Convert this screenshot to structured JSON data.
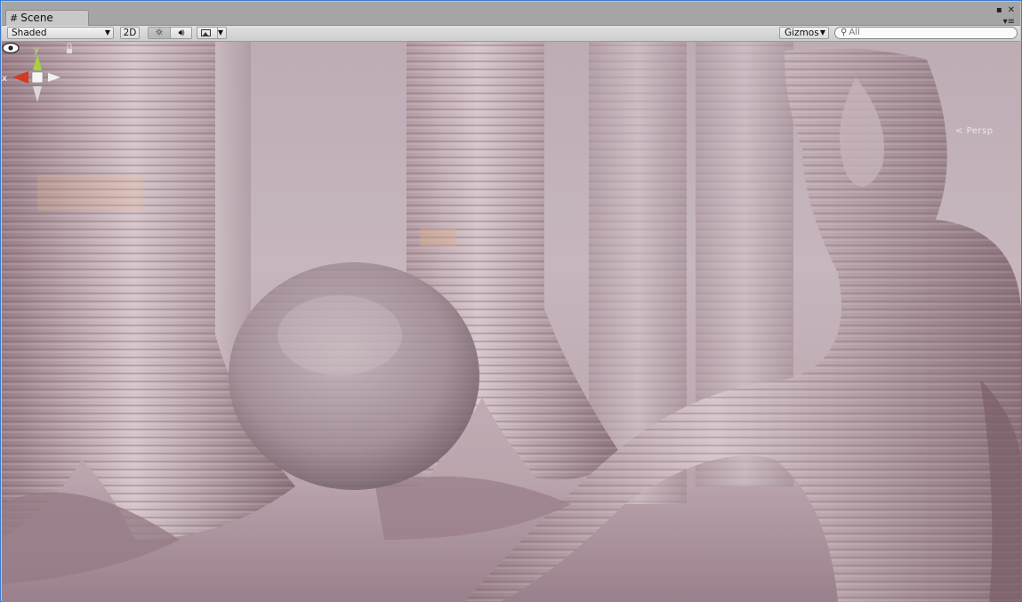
{
  "window": {
    "tab_title": "Scene",
    "tab_icon": "hash-grid-icon"
  },
  "toolbar": {
    "draw_mode": "Shaded",
    "btn_2d": "2D",
    "lighting_icon": "sun-icon",
    "audio_icon": "speaker-icon",
    "effects_icon": "image-icon",
    "gizmos_label": "Gizmos",
    "search_placeholder": "All"
  },
  "scene": {
    "view_mode": "Persp",
    "axis_x": "x",
    "axis_y": "y",
    "colors": {
      "sky": "#c6b5bd",
      "structure": "#a98f97",
      "sphere": "#a8929c",
      "x_axis": "#d23a22",
      "y_axis": "#a6d23c"
    }
  }
}
